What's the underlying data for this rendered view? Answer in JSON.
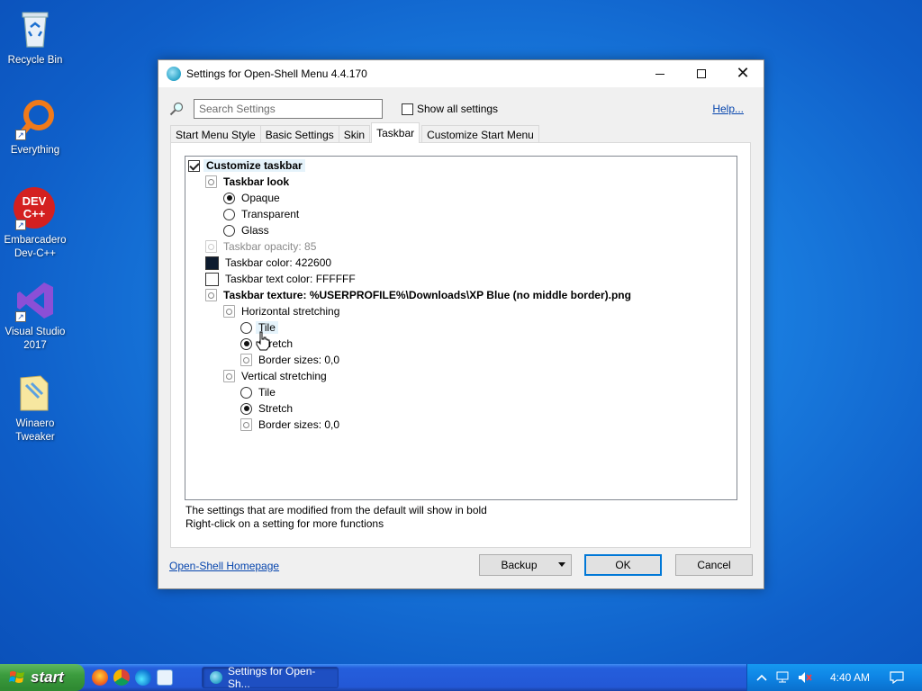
{
  "desktop": {
    "icons": [
      {
        "label": "Recycle Bin"
      },
      {
        "label": "Everything"
      },
      {
        "label": "Embarcadero Dev-C++",
        "logo": "DEV C++"
      },
      {
        "label": "Visual Studio 2017"
      },
      {
        "label": "Winaero Tweaker"
      }
    ]
  },
  "window": {
    "title": "Settings for Open-Shell Menu 4.4.170",
    "search_placeholder": "Search Settings",
    "show_all_label": "Show all settings",
    "help_label": "Help...",
    "tabs": [
      {
        "label": "Start Menu Style"
      },
      {
        "label": "Basic Settings"
      },
      {
        "label": "Skin"
      },
      {
        "label": "Taskbar",
        "active": true
      },
      {
        "label": "Customize Start Menu"
      }
    ],
    "tree": [
      {
        "label": "Customize taskbar",
        "type": "checkbox",
        "checked": true,
        "bold": true
      },
      {
        "label": "Taskbar look",
        "type": "group",
        "bold": true
      },
      {
        "label": "Opaque",
        "type": "radio",
        "selected": true
      },
      {
        "label": "Transparent",
        "type": "radio",
        "selected": false
      },
      {
        "label": "Glass",
        "type": "radio",
        "selected": false
      },
      {
        "label": "Taskbar opacity: 85",
        "type": "setting",
        "disabled": true
      },
      {
        "label": "Taskbar color: 422600",
        "type": "color",
        "color": "#0d1b2e"
      },
      {
        "label": "Taskbar text color: FFFFFF",
        "type": "color",
        "color": "#ffffff"
      },
      {
        "label": "Taskbar texture: %USERPROFILE%\\Downloads\\XP Blue (no middle border).png",
        "type": "setting",
        "bold": true
      },
      {
        "label": "Horizontal stretching",
        "type": "group"
      },
      {
        "label": "Tile",
        "type": "radio",
        "selected": false
      },
      {
        "label": "Stretch",
        "type": "radio",
        "selected": true
      },
      {
        "label": "Border sizes: 0,0",
        "type": "setting"
      },
      {
        "label": "Vertical stretching",
        "type": "group"
      },
      {
        "label": "Tile",
        "type": "radio",
        "selected": false
      },
      {
        "label": "Stretch",
        "type": "radio",
        "selected": true
      },
      {
        "label": "Border sizes: 0,0",
        "type": "setting"
      }
    ],
    "notes": [
      "The settings that are modified from the default will show in bold",
      "Right-click on a setting for more functions"
    ],
    "homepage_link": "Open-Shell Homepage",
    "buttons": {
      "backup": "Backup",
      "ok": "OK",
      "cancel": "Cancel"
    }
  },
  "taskbar": {
    "start_label": "start",
    "task_label": "Settings for Open-Sh...",
    "clock": "4:40 AM"
  },
  "colors": {
    "desktop": "#1a7ee0",
    "taskbar": "#245edc",
    "start_button": "#3c9c3e",
    "link": "#0645ad",
    "ok_border": "#0078d7"
  }
}
